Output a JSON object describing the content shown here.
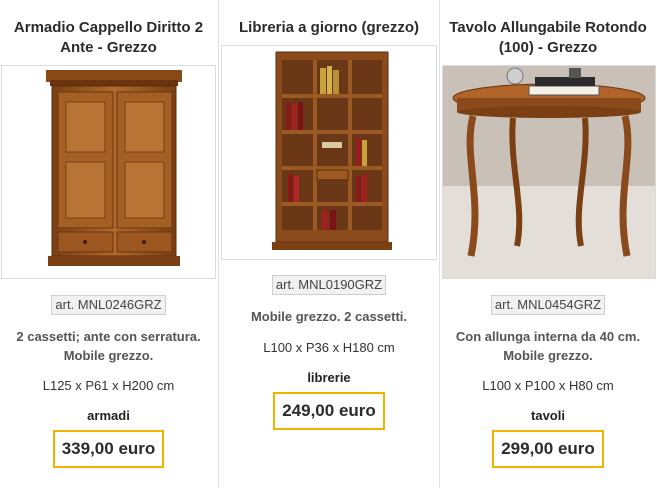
{
  "products": [
    {
      "title": "Armadio Cappello Diritto 2 Ante - Grezzo",
      "article": "art. MNL0246GRZ",
      "description": "2 cassetti; ante con serratura. Mobile grezzo.",
      "dimensions": "L125 x P61 x H200 cm",
      "category": "armadi",
      "price": "339,00 euro",
      "image": "wardrobe-image"
    },
    {
      "title": "Libreria a giorno (grezzo)",
      "article": "art. MNL0190GRZ",
      "description": "Mobile grezzo. 2 cassetti.",
      "dimensions": "L100 x P36 x H180 cm",
      "category": "librerie",
      "price": "249,00 euro",
      "image": "bookcase-image"
    },
    {
      "title": "Tavolo Allungabile Rotondo (100) - Grezzo",
      "article": "art. MNL0454GRZ",
      "description": "Con allunga interna da 40 cm. Mobile grezzo.",
      "dimensions": "L100 x P100 x H80 cm",
      "category": "tavoli",
      "price": "299,00 euro",
      "image": "round-table-image"
    }
  ],
  "colors": {
    "price_border": "#f0b400",
    "wood": "#9a5a1f"
  }
}
